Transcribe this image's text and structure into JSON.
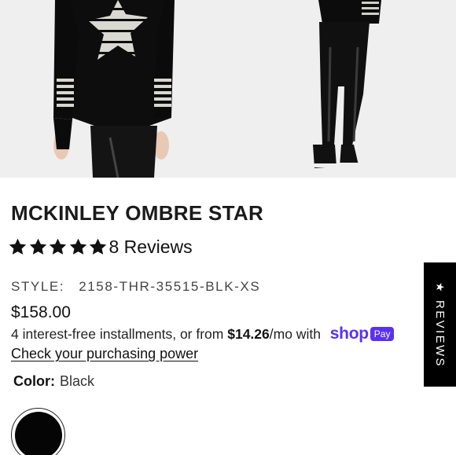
{
  "product": {
    "title": "MCKINLEY OMBRE STAR",
    "rating": 5,
    "reviews_label": "8 Reviews",
    "style_label": "STYLE:",
    "style_value": "2158-THR-35515-BLK-XS",
    "price": "$158.00"
  },
  "installments": {
    "prefix": "4 interest-free installments, or from ",
    "amount": "$14.26",
    "suffix": "/mo with ",
    "shop_word": "shop",
    "pay_badge": "Pay"
  },
  "purchasing_power_link": "Check your purchasing power",
  "color": {
    "label": "Color:",
    "value": "Black",
    "swatch_hex": "#050505"
  },
  "reviews_tab": {
    "star": "★",
    "label": "REVIEWS"
  },
  "theme": {
    "accent_shoppay": "#5a31f4",
    "star_color": "#111111"
  }
}
